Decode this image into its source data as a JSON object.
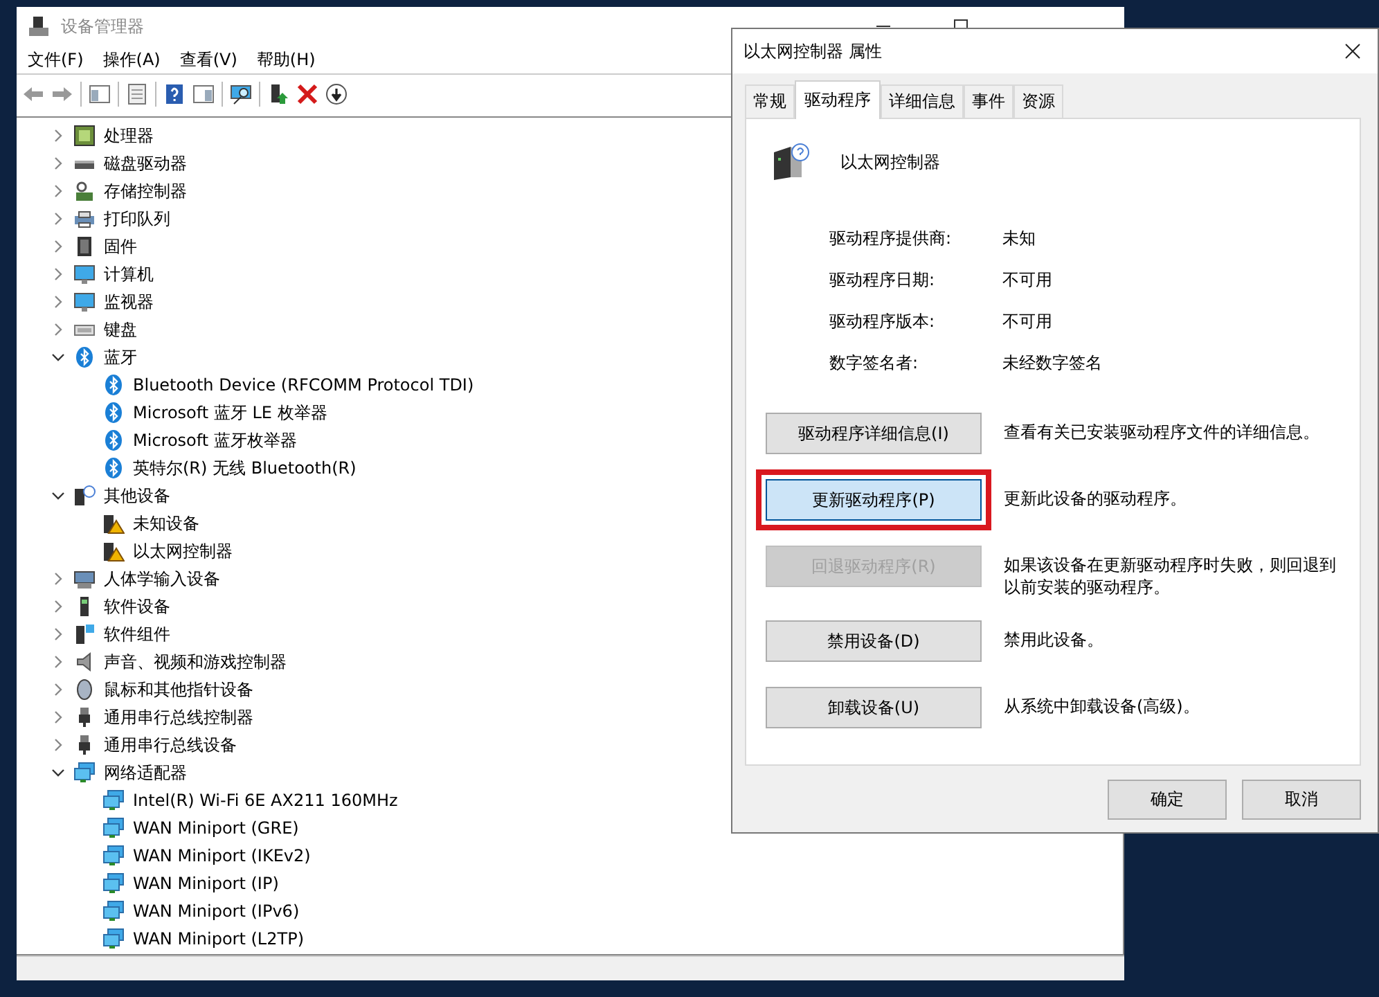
{
  "main_window": {
    "title": "设备管理器",
    "menu": [
      "文件(F)",
      "操作(A)",
      "查看(V)",
      "帮助(H)"
    ],
    "tree": [
      {
        "label": "处理器",
        "kind": "cpu",
        "expanded": false
      },
      {
        "label": "磁盘驱动器",
        "kind": "disk",
        "expanded": false
      },
      {
        "label": "存储控制器",
        "kind": "storage",
        "expanded": false
      },
      {
        "label": "打印队列",
        "kind": "printer",
        "expanded": false
      },
      {
        "label": "固件",
        "kind": "firmware",
        "expanded": false
      },
      {
        "label": "计算机",
        "kind": "monitor",
        "expanded": false
      },
      {
        "label": "监视器",
        "kind": "monitor",
        "expanded": false
      },
      {
        "label": "键盘",
        "kind": "keyboard",
        "expanded": false
      },
      {
        "label": "蓝牙",
        "kind": "bluetooth",
        "expanded": true,
        "children": [
          {
            "label": "Bluetooth Device (RFCOMM Protocol TDI)",
            "kind": "bluetooth"
          },
          {
            "label": "Microsoft 蓝牙 LE 枚举器",
            "kind": "bluetooth"
          },
          {
            "label": "Microsoft 蓝牙枚举器",
            "kind": "bluetooth"
          },
          {
            "label": "英特尔(R) 无线 Bluetooth(R)",
            "kind": "bluetooth"
          }
        ]
      },
      {
        "label": "其他设备",
        "kind": "unknown",
        "expanded": true,
        "children": [
          {
            "label": "未知设备",
            "kind": "warning"
          },
          {
            "label": "以太网控制器",
            "kind": "warning"
          }
        ]
      },
      {
        "label": "人体学输入设备",
        "kind": "hid",
        "expanded": false
      },
      {
        "label": "软件设备",
        "kind": "software",
        "expanded": false
      },
      {
        "label": "软件组件",
        "kind": "component",
        "expanded": false
      },
      {
        "label": "声音、视频和游戏控制器",
        "kind": "audio",
        "expanded": false
      },
      {
        "label": "鼠标和其他指针设备",
        "kind": "mouse",
        "expanded": false
      },
      {
        "label": "通用串行总线控制器",
        "kind": "usb",
        "expanded": false
      },
      {
        "label": "通用串行总线设备",
        "kind": "usb",
        "expanded": false
      },
      {
        "label": "网络适配器",
        "kind": "network",
        "expanded": true,
        "children": [
          {
            "label": "Intel(R) Wi-Fi 6E AX211 160MHz",
            "kind": "network"
          },
          {
            "label": "WAN Miniport (GRE)",
            "kind": "network"
          },
          {
            "label": "WAN Miniport (IKEv2)",
            "kind": "network"
          },
          {
            "label": "WAN Miniport (IP)",
            "kind": "network"
          },
          {
            "label": "WAN Miniport (IPv6)",
            "kind": "network"
          },
          {
            "label": "WAN Miniport (L2TP)",
            "kind": "network"
          }
        ]
      }
    ]
  },
  "dialog": {
    "title": "以太网控制器 属性",
    "tabs": [
      {
        "label": "常规",
        "selected": false
      },
      {
        "label": "驱动程序",
        "selected": true
      },
      {
        "label": "详细信息",
        "selected": false
      },
      {
        "label": "事件",
        "selected": false
      },
      {
        "label": "资源",
        "selected": false
      }
    ],
    "device_name": "以太网控制器",
    "properties": [
      {
        "label": "驱动程序提供商:",
        "value": "未知"
      },
      {
        "label": "驱动程序日期:",
        "value": "不可用"
      },
      {
        "label": "驱动程序版本:",
        "value": "不可用"
      },
      {
        "label": "数字签名者:",
        "value": "未经数字签名"
      }
    ],
    "actions": [
      {
        "button": "驱动程序详细信息(I)",
        "description": "查看有关已安装驱动程序文件的详细信息。",
        "disabled": false,
        "focused": false,
        "highlighted": false
      },
      {
        "button": "更新驱动程序(P)",
        "description": "更新此设备的驱动程序。",
        "disabled": false,
        "focused": true,
        "highlighted": true
      },
      {
        "button": "回退驱动程序(R)",
        "description": "如果该设备在更新驱动程序时失败，则回退到以前安装的驱动程序。",
        "disabled": true,
        "focused": false,
        "highlighted": false
      },
      {
        "button": "禁用设备(D)",
        "description": "禁用此设备。",
        "disabled": false,
        "focused": false,
        "highlighted": false
      },
      {
        "button": "卸载设备(U)",
        "description": "从系统中卸载设备(高级)。",
        "disabled": false,
        "focused": false,
        "highlighted": false
      }
    ],
    "buttons": [
      "确定",
      "取消"
    ]
  }
}
